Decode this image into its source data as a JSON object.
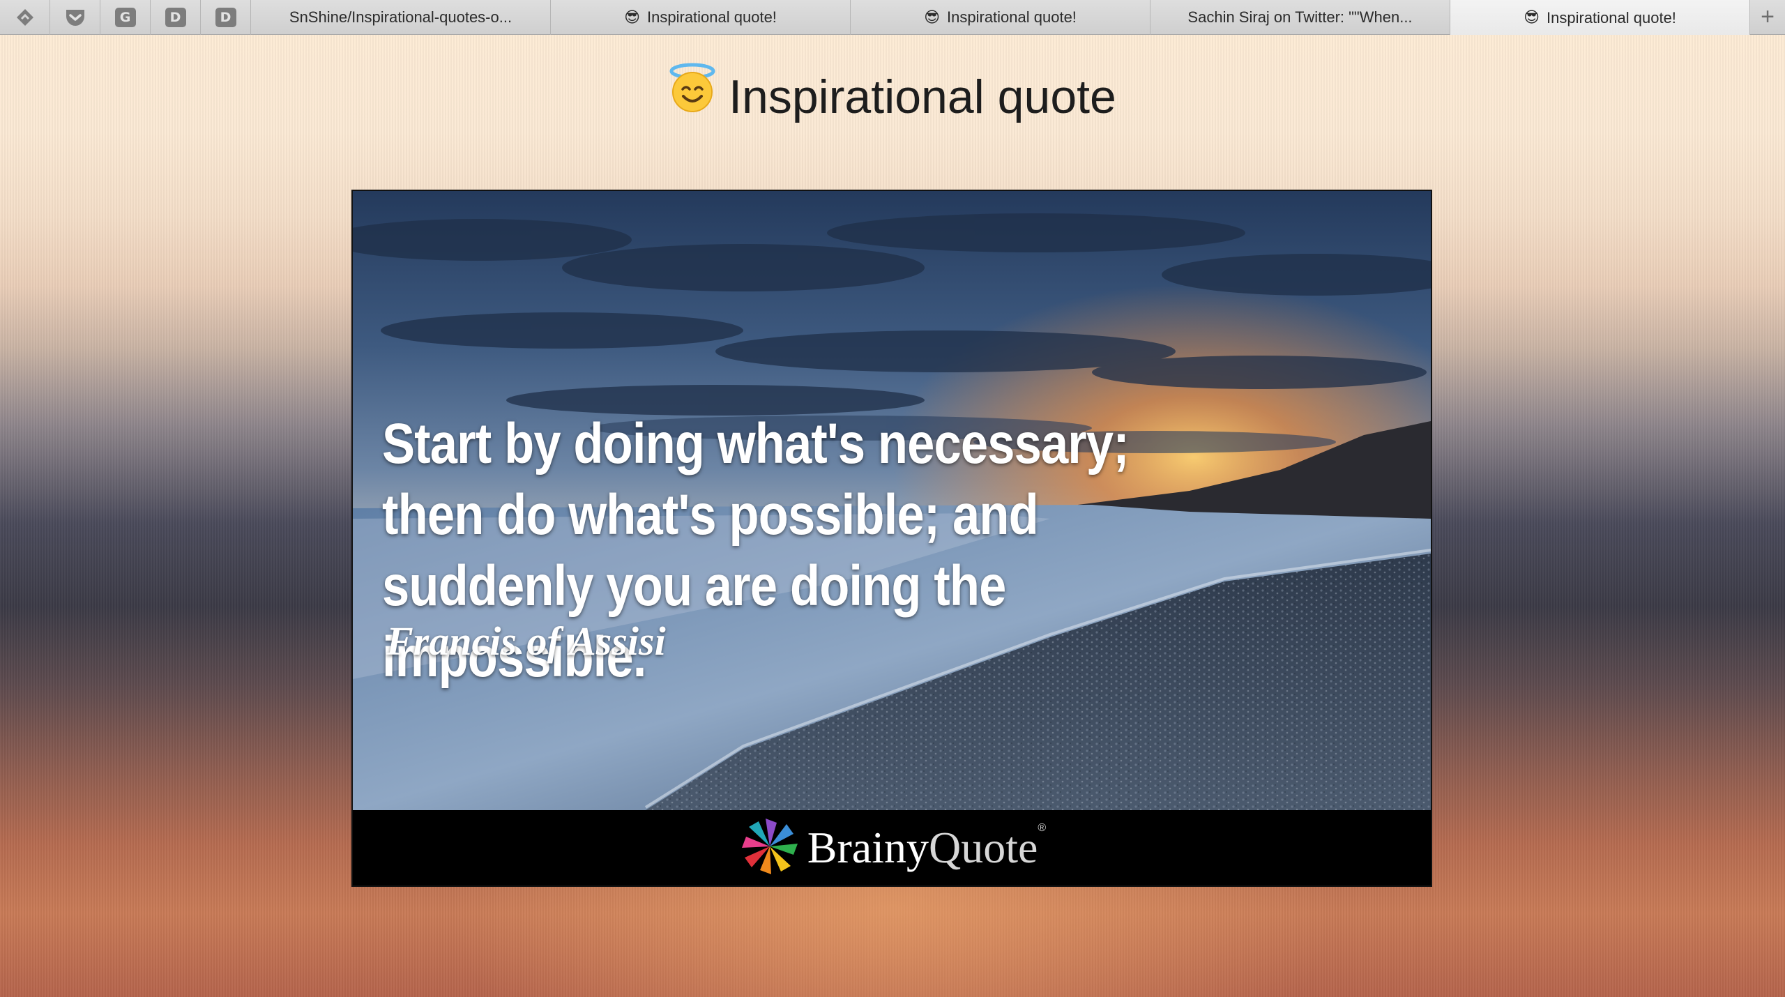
{
  "tabbar": {
    "pinned": [
      {
        "label": ""
      },
      {
        "label": ""
      },
      {
        "label": "G"
      },
      {
        "label": "D"
      },
      {
        "label": "D"
      }
    ],
    "tabs": [
      {
        "title": "SnShine/Inspirational-quotes-o...",
        "favicon": ""
      },
      {
        "title": "Inspirational quote!",
        "favicon": "😎"
      },
      {
        "title": "Inspirational quote!",
        "favicon": "😎"
      },
      {
        "title": "Sachin Siraj on Twitter: \"\"When...",
        "favicon": ""
      },
      {
        "title": "Inspirational quote!",
        "favicon": "😎"
      }
    ],
    "new_tab_label": "+"
  },
  "page": {
    "title": "Inspirational quote",
    "quote": {
      "line1": "Start by doing what's necessary;",
      "line2": "then do what's possible; and",
      "line3": "suddenly you are doing the impossible.",
      "author": "Francis of Assisi"
    },
    "brand": {
      "part1": "Brainy",
      "part2": "Quote",
      "reg": "®"
    }
  }
}
